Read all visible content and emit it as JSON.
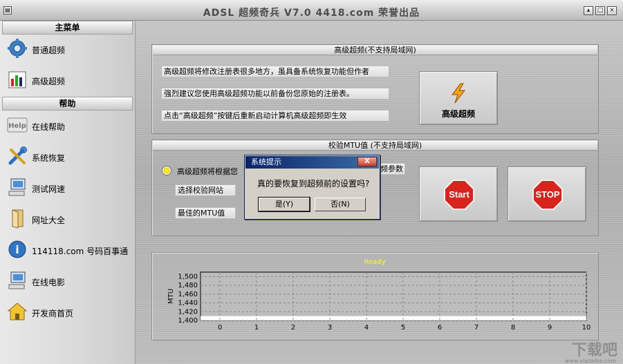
{
  "window": {
    "title": "ADSL 超频奇兵 V7.0  4418.com 荣誉出品",
    "sys_icon": "▤",
    "min": "▴",
    "max": "□",
    "close": "×"
  },
  "sidebar": {
    "main_menu_header": "主菜单",
    "help_header": "帮助",
    "main_items": [
      {
        "label": "普通超频",
        "icon": "gear-icon"
      },
      {
        "label": "高级超频",
        "icon": "chart-icon"
      }
    ],
    "help_items": [
      {
        "label": "在线帮助",
        "icon": "help-icon"
      },
      {
        "label": "系统恢复",
        "icon": "tools-icon"
      },
      {
        "label": "测试网速",
        "icon": "computer-icon"
      },
      {
        "label": "网址大全",
        "icon": "door-icon"
      },
      {
        "label": "114118.com 号码百事通",
        "icon": "info-icon"
      },
      {
        "label": "在线电影",
        "icon": "computer-icon"
      },
      {
        "label": "开发商首页",
        "icon": "home-icon"
      }
    ],
    "help_icon_text": "Help"
  },
  "advanced": {
    "header": "高级超频(不支持局域网)",
    "notes": [
      "高级超频将修改注册表很多地方，虽具备系统恢复功能但作者",
      "强烈建议您使用高级超频功能以前备份您原始的注册表。",
      "点击“高级超频”按键后重新启动计算机高级超频即生效"
    ],
    "button_label": "高级超频"
  },
  "mtu": {
    "header": "校验MTU值 (不支持局域网)",
    "radio_label_left": "高级超频将根据您",
    "radio_label_right": "频参数",
    "site_label": "选择校验网站",
    "best_label": "最佳的MTU值",
    "start_label": "Start",
    "stop_label": "STOP"
  },
  "chart_data": {
    "type": "line",
    "title": "Ready",
    "ylabel": "MTU",
    "xlabel": "",
    "x_ticks": [
      0,
      1,
      2,
      3,
      4,
      5,
      6,
      7,
      8,
      9,
      10
    ],
    "y_ticks": [
      "1,400",
      "1,420",
      "1,440",
      "1,460",
      "1,480",
      "1,500"
    ],
    "xlim": [
      0,
      10
    ],
    "ylim": [
      1400,
      1510
    ],
    "series": [],
    "grid": true,
    "colors": {
      "title": "#ffff00",
      "plot_bg": "#ffffff",
      "grid": "#888888"
    }
  },
  "dialog": {
    "title": "系统提示",
    "message": "真的要恢复到超频前的设置吗?",
    "yes": "是(Y)",
    "no": "否(N)",
    "close": "X"
  },
  "watermark": {
    "text": "下载吧",
    "sub": "www.xiazaiba.com"
  }
}
